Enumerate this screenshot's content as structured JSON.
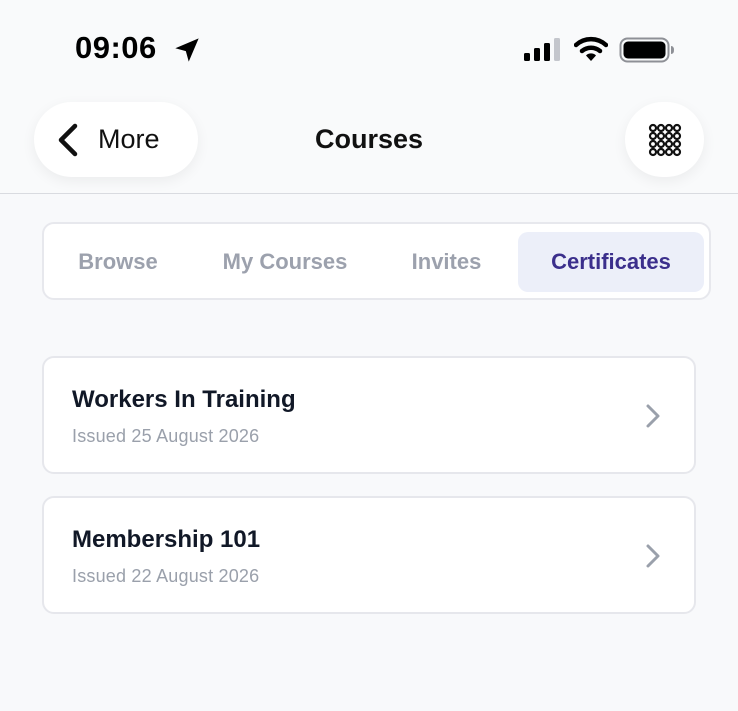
{
  "status_bar": {
    "time": "09:06"
  },
  "header": {
    "back_label": "More",
    "title": "Courses"
  },
  "tabs": [
    {
      "label": "Browse",
      "active": false
    },
    {
      "label": "My Courses",
      "active": false
    },
    {
      "label": "Invites",
      "active": false
    },
    {
      "label": "Certificates",
      "active": true
    }
  ],
  "certificates": [
    {
      "title": "Workers In Training",
      "issued": "Issued 25 August 2026"
    },
    {
      "title": "Membership 101",
      "issued": "Issued 22 August 2026"
    }
  ],
  "colors": {
    "accent": "#3b2f8c",
    "active_tab_bg": "#eceff9",
    "muted_text": "#9ca1ad"
  },
  "icons": [
    "location-arrow-icon",
    "cellular-signal-icon",
    "wifi-icon",
    "battery-icon",
    "chevron-left-icon",
    "grid-menu-icon",
    "chevron-right-icon"
  ]
}
